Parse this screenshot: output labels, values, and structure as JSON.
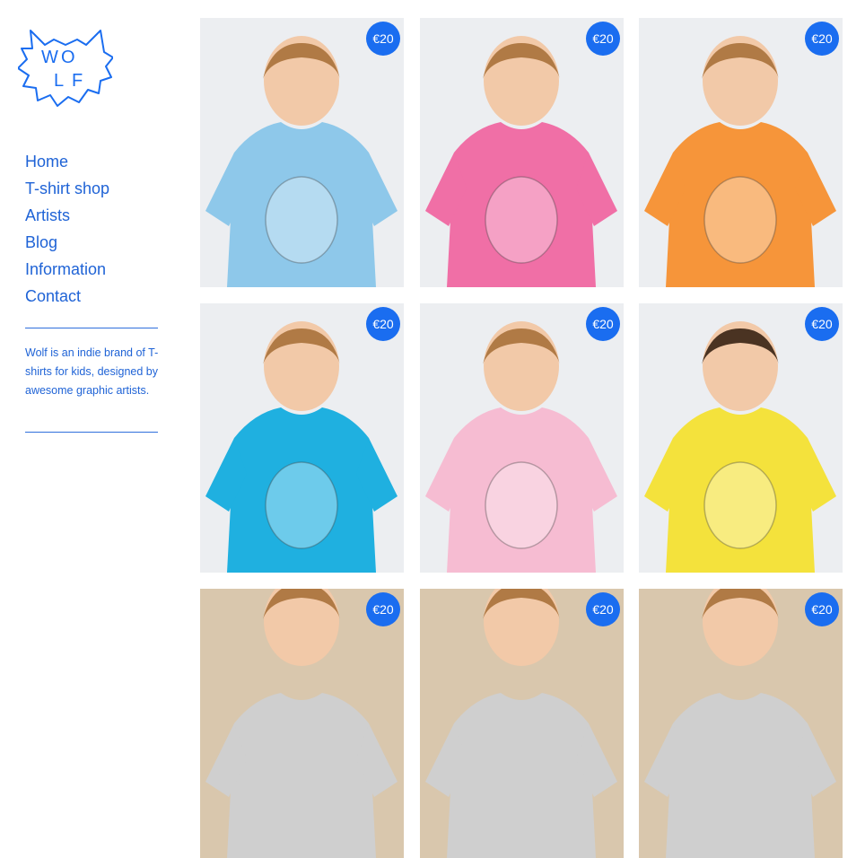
{
  "brand": {
    "logo_letters": [
      "W",
      "O",
      "L",
      "F"
    ],
    "accent_color": "#1a6df0",
    "link_color": "#1f63d6"
  },
  "nav": {
    "items": [
      {
        "label": "Home"
      },
      {
        "label": "T-shirt shop"
      },
      {
        "label": "Artists"
      },
      {
        "label": "Blog"
      },
      {
        "label": "Information"
      },
      {
        "label": "Contact"
      }
    ]
  },
  "about": {
    "text": "Wolf is an indie brand of T-shirts for kids, designed by awesome graphic artists."
  },
  "products": [
    {
      "price": "€20",
      "tshirt_color": "#8ec8ea",
      "illustration": "lion-chief"
    },
    {
      "price": "€20",
      "tshirt_color": "#f06fa6",
      "illustration": "raccoon"
    },
    {
      "price": "€20",
      "tshirt_color": "#f6953a",
      "illustration": "strongman"
    },
    {
      "price": "€20",
      "tshirt_color": "#1fb0e0",
      "illustration": "ice-cream"
    },
    {
      "price": "€20",
      "tshirt_color": "#f6bcd2",
      "illustration": "fox"
    },
    {
      "price": "€20",
      "tshirt_color": "#f4e23c",
      "illustration": "diamond-frog"
    },
    {
      "price": "€20",
      "tshirt_color": "#cfcfcf",
      "illustration": ""
    },
    {
      "price": "€20",
      "tshirt_color": "#cfcfcf",
      "illustration": ""
    },
    {
      "price": "€20",
      "tshirt_color": "#cfcfcf",
      "illustration": ""
    }
  ]
}
